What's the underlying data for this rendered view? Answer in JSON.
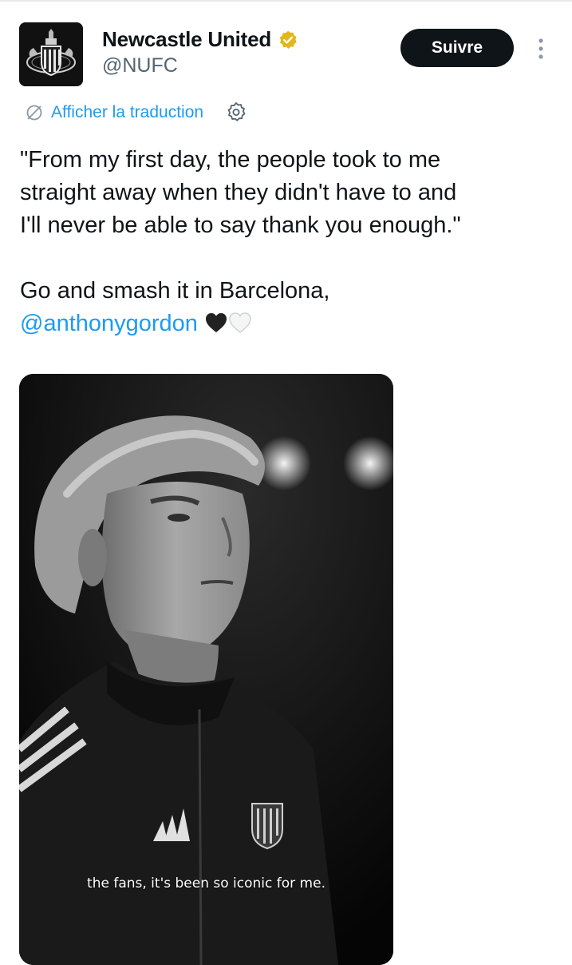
{
  "account": {
    "display_name": "Newcastle United",
    "handle": "@NUFC",
    "avatar_icon": "newcastle-crest-icon",
    "verified_badge_color": "#e2b719"
  },
  "actions": {
    "follow_label": "Suivre",
    "more_icon": "more-vertical-icon"
  },
  "translation": {
    "link_label": "Afficher la traduction",
    "translate_icon": "translate-icon",
    "settings_icon": "gear-icon"
  },
  "tweet": {
    "quote_line_1": "\"From my first day, the people took to me",
    "quote_line_2": "straight away when they didn't have to and",
    "quote_line_3": "I'll never be able to say thank you enough.\"",
    "closing_text": "Go and smash it in Barcelona,",
    "mention": "@anthonygordon",
    "emoji": [
      "black-heart-icon",
      "white-heart-icon"
    ]
  },
  "media": {
    "caption": "the fans, it's been so iconic for me."
  },
  "colors": {
    "accent": "#1d9bf0",
    "text_primary": "#0f1419",
    "text_secondary": "#536471",
    "button_bg": "#0f1419"
  }
}
